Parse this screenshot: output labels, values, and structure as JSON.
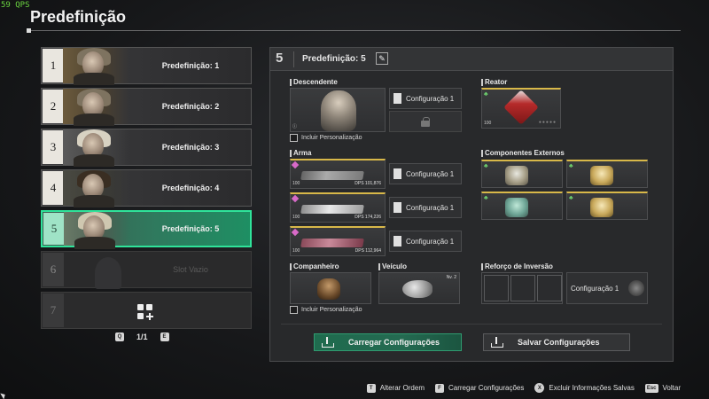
{
  "fps": "59 QPS",
  "page_title": "Predefinição",
  "presets": [
    {
      "num": "1",
      "label": "Predefinição: 1",
      "state": "filled"
    },
    {
      "num": "2",
      "label": "Predefinição: 2",
      "state": "filled"
    },
    {
      "num": "3",
      "label": "Predefinição: 3",
      "state": "filled"
    },
    {
      "num": "4",
      "label": "Predefinição: 4",
      "state": "filled"
    },
    {
      "num": "5",
      "label": "Predefinição: 5",
      "state": "selected"
    },
    {
      "num": "6",
      "label": "Slot Vazio",
      "state": "empty"
    },
    {
      "num": "7",
      "label": "",
      "state": "add"
    }
  ],
  "pager": {
    "prev_key": "Q",
    "page": "1/1",
    "next_key": "E"
  },
  "panel": {
    "number": "5",
    "title": "Predefinição: 5",
    "descendente": {
      "label": "Descendente",
      "config": "Configuração 1",
      "checkbox": "Incluir Personalização"
    },
    "reator": {
      "label": "Reator",
      "level": "100"
    },
    "arma": {
      "label": "Arma",
      "weapons": [
        {
          "level": "100",
          "dps_label": "DPS",
          "dps": "101,876",
          "config": "Configuração 1"
        },
        {
          "level": "100",
          "dps_label": "DPS",
          "dps": "174,226",
          "config": "Configuração 1"
        },
        {
          "level": "100",
          "dps_label": "DPS",
          "dps": "112,964",
          "config": "Configuração 1"
        }
      ]
    },
    "componentes": {
      "label": "Componentes Externos"
    },
    "companheiro": {
      "label": "Companheiro",
      "checkbox": "Incluir Personalização"
    },
    "veiculo": {
      "label": "Veículo",
      "badge": "Nv. 2"
    },
    "reforco": {
      "label": "Reforço de Inversão",
      "config": "Configuração 1"
    },
    "load_button": "Carregar Configurações",
    "save_button": "Salvar Configurações"
  },
  "footer": [
    {
      "key": "T",
      "label": "Alterar Ordem"
    },
    {
      "key": "F",
      "label": "Carregar Configurações"
    },
    {
      "key": "X",
      "label": "Excluir Informações Salvas"
    },
    {
      "key": "Esc",
      "label": "Voltar"
    }
  ],
  "colors": {
    "accent": "#2fe39a",
    "gold": "#d8b849",
    "panel_bg": "#28292b"
  }
}
